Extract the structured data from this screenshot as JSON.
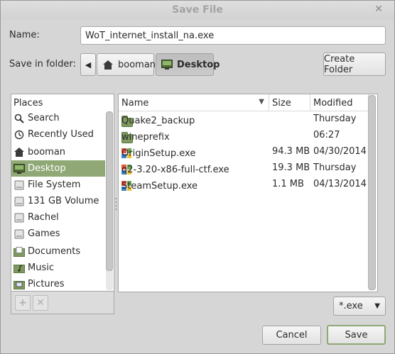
{
  "window": {
    "title": "Save File"
  },
  "name_field": {
    "label": "Name:",
    "value": "WoT_internet_install_na.exe"
  },
  "folder": {
    "label": "Save in folder:",
    "path": [
      {
        "label": "booman",
        "icon": "home-icon"
      },
      {
        "label": "Desktop",
        "icon": "desktop-icon",
        "active": true
      }
    ],
    "create_label": "Create Folder"
  },
  "places": {
    "header": "Places",
    "items": [
      {
        "label": "Search",
        "icon": "search-icon"
      },
      {
        "label": "Recently Used",
        "icon": "recent-icon"
      },
      {
        "label": "booman",
        "icon": "home-icon"
      },
      {
        "label": "Desktop",
        "icon": "desktop-icon",
        "selected": true
      },
      {
        "label": "File System",
        "icon": "drive-icon"
      },
      {
        "label": "131 GB Volume",
        "icon": "drive-icon"
      },
      {
        "label": "Rachel",
        "icon": "drive-icon"
      },
      {
        "label": "Games",
        "icon": "drive-icon"
      },
      {
        "label": "Documents",
        "icon": "documents-icon"
      },
      {
        "label": "Music",
        "icon": "music-icon"
      },
      {
        "label": "Pictures",
        "icon": "pictures-icon"
      }
    ]
  },
  "files": {
    "columns": {
      "name": "Name",
      "size": "Size",
      "modified": "Modified"
    },
    "rows": [
      {
        "name": "Quake2_backup",
        "size": "",
        "modified": "Thursday",
        "icon": "folder-icon"
      },
      {
        "name": "wineprefix",
        "size": "",
        "modified": "06:27",
        "icon": "folder-icon"
      },
      {
        "name": "OriginSetup.exe",
        "size": "94.3 MB",
        "modified": "04/30/2014",
        "icon": "windows-exe-icon"
      },
      {
        "name": "q2-3.20-x86-full-ctf.exe",
        "size": "19.3 MB",
        "modified": "Thursday",
        "icon": "windows-exe-icon"
      },
      {
        "name": "SteamSetup.exe",
        "size": "1.1 MB",
        "modified": "04/13/2014",
        "icon": "windows-exe-icon"
      }
    ]
  },
  "filter": {
    "value": "*.exe"
  },
  "buttons": {
    "cancel": "Cancel",
    "save": "Save"
  },
  "colors": {
    "selection": "#8fa876",
    "folder": "#7e9a5f"
  }
}
